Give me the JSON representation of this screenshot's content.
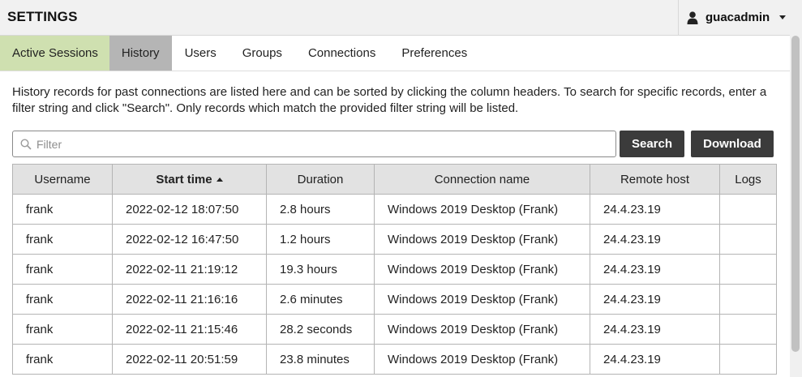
{
  "header": {
    "title": "SETTINGS",
    "user": {
      "name": "guacadmin",
      "icon": "user-icon"
    }
  },
  "tabs": [
    {
      "label": "Active Sessions",
      "color": "#cfe0b0"
    },
    {
      "label": "History",
      "color": "#b5b5b5",
      "active": true
    },
    {
      "label": "Users"
    },
    {
      "label": "Groups"
    },
    {
      "label": "Connections"
    },
    {
      "label": "Preferences"
    }
  ],
  "description": "History records for past connections are listed here and can be sorted by clicking the column headers. To search for specific records, enter a filter string and click \"Search\". Only records which match the provided filter string will be listed.",
  "filter": {
    "placeholder": "Filter",
    "value": "",
    "icon": "search-icon"
  },
  "buttons": {
    "search": "Search",
    "download": "Download"
  },
  "table": {
    "columns": [
      "Username",
      "Start time",
      "Duration",
      "Connection name",
      "Remote host",
      "Logs"
    ],
    "sorted_column": "Start time",
    "sort_direction": "ascending",
    "rows": [
      [
        "frank",
        "2022-02-12 18:07:50",
        "2.8 hours",
        "Windows 2019 Desktop (Frank)",
        "24.4.23.19",
        ""
      ],
      [
        "frank",
        "2022-02-12 16:47:50",
        "1.2 hours",
        "Windows 2019 Desktop (Frank)",
        "24.4.23.19",
        ""
      ],
      [
        "frank",
        "2022-02-11 21:19:12",
        "19.3 hours",
        "Windows 2019 Desktop (Frank)",
        "24.4.23.19",
        ""
      ],
      [
        "frank",
        "2022-02-11 21:16:16",
        "2.6 minutes",
        "Windows 2019 Desktop (Frank)",
        "24.4.23.19",
        ""
      ],
      [
        "frank",
        "2022-02-11 21:15:46",
        "28.2 seconds",
        "Windows 2019 Desktop (Frank)",
        "24.4.23.19",
        ""
      ],
      [
        "frank",
        "2022-02-11 20:51:59",
        "23.8 minutes",
        "Windows 2019 Desktop (Frank)",
        "24.4.23.19",
        ""
      ]
    ]
  },
  "colors": {
    "button_bg": "#3b3b3b",
    "header_bg": "#f1f1f1",
    "table_header_bg": "#e2e2e2"
  }
}
